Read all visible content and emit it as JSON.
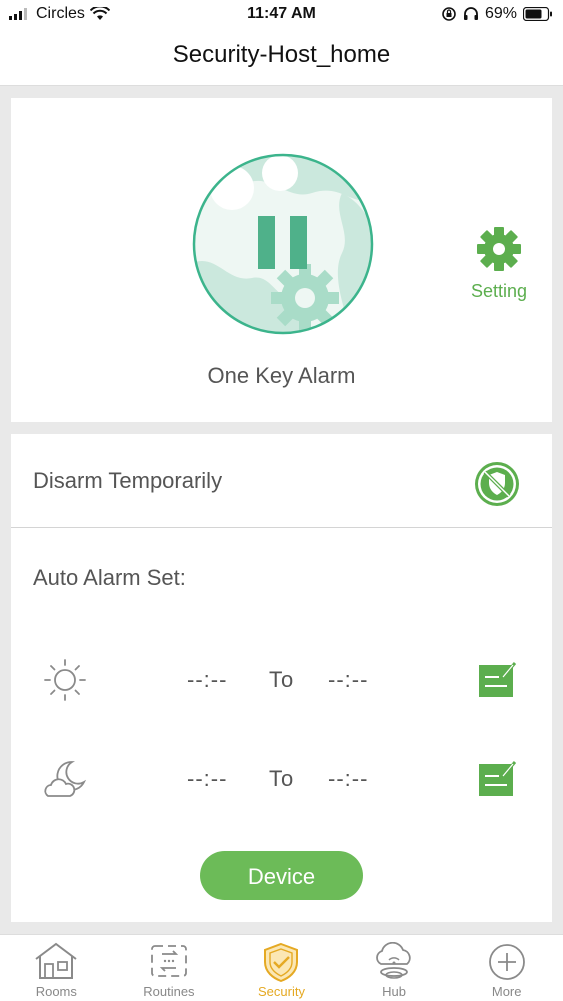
{
  "status_bar": {
    "carrier": "Circles",
    "time": "11:47 AM",
    "battery": "69%"
  },
  "header": {
    "title": "Security-Host_home"
  },
  "alarm": {
    "label": "One Key Alarm",
    "setting_label": "Setting"
  },
  "disarm": {
    "label": "Disarm Temporarily"
  },
  "auto_alarm": {
    "label": "Auto Alarm Set:",
    "day": {
      "from": "--:--",
      "to_label": "To",
      "to": "--:--"
    },
    "night": {
      "from": "--:--",
      "to_label": "To",
      "to": "--:--"
    }
  },
  "device_button": "Device",
  "tabs": [
    {
      "label": "Rooms",
      "icon": "house-icon"
    },
    {
      "label": "Routines",
      "icon": "routines-icon"
    },
    {
      "label": "Security",
      "icon": "shield-check-icon",
      "active": true
    },
    {
      "label": "Hub",
      "icon": "cloud-hub-icon"
    },
    {
      "label": "More",
      "icon": "plus-circle-icon"
    }
  ],
  "colors": {
    "accent_green": "#5cae4e",
    "button_green": "#6cbb58",
    "active_tab": "#e5a923",
    "alarm_teal": "#3cb48c"
  }
}
